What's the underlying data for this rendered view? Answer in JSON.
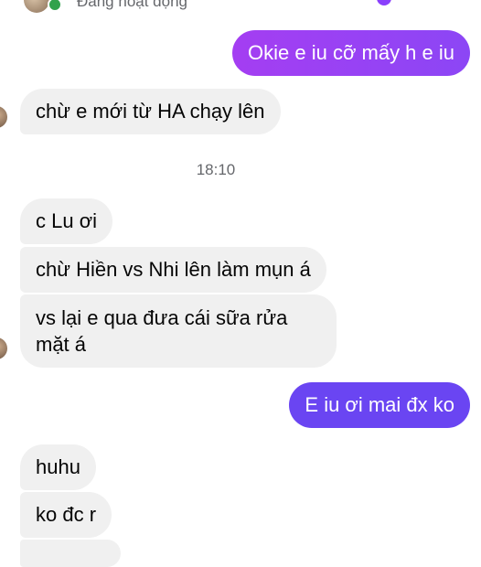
{
  "header": {
    "status": "Đang hoạt động",
    "avatar_icon": "contact-avatar-icon",
    "online_icon": "online-dot-icon"
  },
  "colors": {
    "outgoing_gradient_start": "#a43ef2",
    "outgoing_gradient_end": "#8c46f5",
    "outgoing_blue_violet": "#6a45f2",
    "incoming_bubble": "#f0f0f0",
    "timestamp_text": "#65676b",
    "online": "#31a24c"
  },
  "messages": {
    "m1": "Okie e iu cỡ mấy h e iu",
    "m2": "chừ e mới từ HA chạy lên",
    "time": "18:10",
    "m3": "c Lu ơi",
    "m4": "chừ Hiền vs Nhi lên làm mụn á",
    "m5": "vs lại e qua đưa cái sữa rửa mặt á",
    "m6": "E iu ơi mai đx ko",
    "m7": "huhu",
    "m8": "ko đc r"
  }
}
